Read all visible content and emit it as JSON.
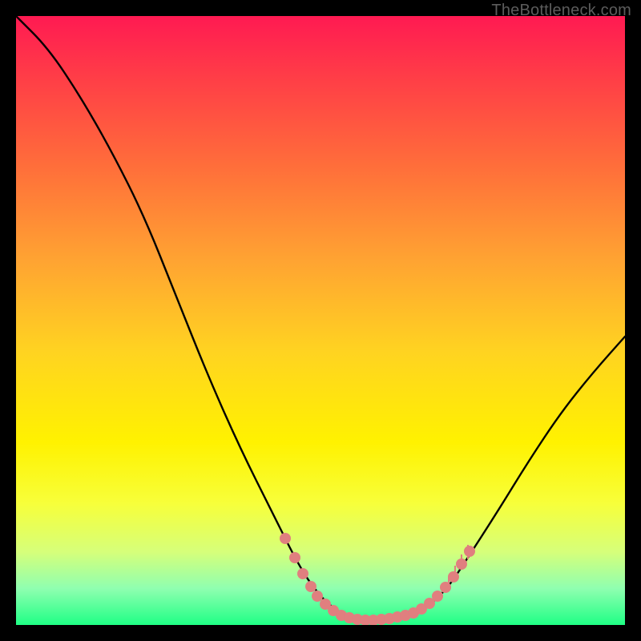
{
  "attribution": "TheBottleneck.com",
  "chart_data": {
    "type": "line",
    "title": "",
    "xlabel": "",
    "ylabel": "",
    "xlim": [
      0,
      760
    ],
    "ylim": [
      0,
      760
    ],
    "curve": [
      {
        "x": 0,
        "y": 760
      },
      {
        "x": 40,
        "y": 720
      },
      {
        "x": 80,
        "y": 660
      },
      {
        "x": 120,
        "y": 590
      },
      {
        "x": 160,
        "y": 510
      },
      {
        "x": 200,
        "y": 410
      },
      {
        "x": 240,
        "y": 310
      },
      {
        "x": 280,
        "y": 220
      },
      {
        "x": 320,
        "y": 140
      },
      {
        "x": 355,
        "y": 70
      },
      {
        "x": 380,
        "y": 35
      },
      {
        "x": 400,
        "y": 18
      },
      {
        "x": 420,
        "y": 8
      },
      {
        "x": 440,
        "y": 5
      },
      {
        "x": 460,
        "y": 6
      },
      {
        "x": 480,
        "y": 10
      },
      {
        "x": 500,
        "y": 15
      },
      {
        "x": 520,
        "y": 28
      },
      {
        "x": 540,
        "y": 48
      },
      {
        "x": 560,
        "y": 78
      },
      {
        "x": 600,
        "y": 140
      },
      {
        "x": 640,
        "y": 205
      },
      {
        "x": 680,
        "y": 265
      },
      {
        "x": 720,
        "y": 315
      },
      {
        "x": 760,
        "y": 360
      }
    ],
    "markers_left": [
      {
        "x": 336,
        "y": 108
      },
      {
        "x": 348,
        "y": 84
      },
      {
        "x": 358,
        "y": 64
      },
      {
        "x": 368,
        "y": 48
      },
      {
        "x": 376,
        "y": 36
      },
      {
        "x": 386,
        "y": 26
      },
      {
        "x": 396,
        "y": 18
      },
      {
        "x": 406,
        "y": 12
      },
      {
        "x": 416,
        "y": 9
      },
      {
        "x": 426,
        "y": 7
      },
      {
        "x": 436,
        "y": 6
      },
      {
        "x": 446,
        "y": 6
      },
      {
        "x": 456,
        "y": 7
      },
      {
        "x": 466,
        "y": 8
      },
      {
        "x": 476,
        "y": 10
      },
      {
        "x": 486,
        "y": 12
      },
      {
        "x": 496,
        "y": 15
      },
      {
        "x": 506,
        "y": 20
      },
      {
        "x": 516,
        "y": 27
      },
      {
        "x": 526,
        "y": 36
      },
      {
        "x": 536,
        "y": 47
      },
      {
        "x": 546,
        "y": 60
      },
      {
        "x": 556,
        "y": 76
      },
      {
        "x": 566,
        "y": 92
      }
    ],
    "ticks_right": [
      {
        "x": 540,
        "y1": 48,
        "y2": 60
      },
      {
        "x": 548,
        "y1": 58,
        "y2": 74
      },
      {
        "x": 556,
        "y1": 70,
        "y2": 88
      },
      {
        "x": 564,
        "y1": 82,
        "y2": 100
      }
    ],
    "marker_color": "#e07f7f",
    "curve_color": "#000000"
  }
}
